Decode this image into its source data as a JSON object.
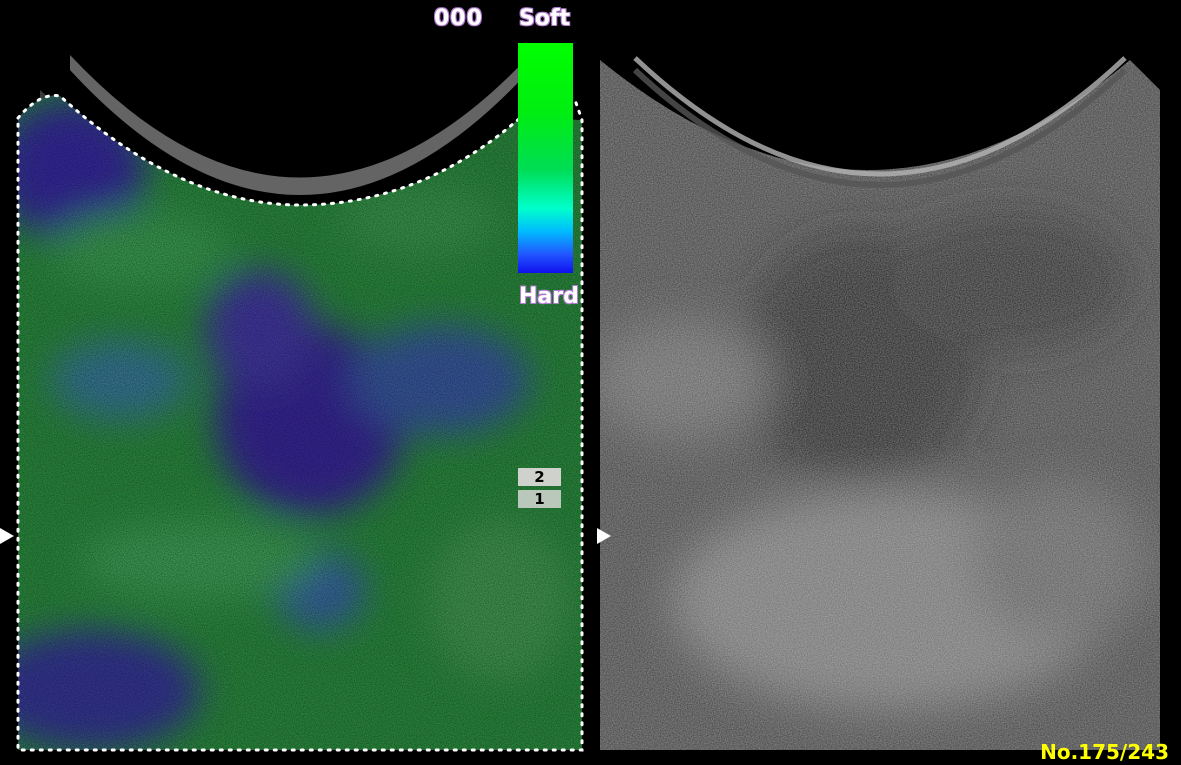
{
  "elastography": {
    "counter": "000",
    "scale_top_label": "Soft",
    "scale_bottom_label": "Hard",
    "scale_colors": [
      "#00ff00",
      "#00dd55",
      "#00ffcc",
      "#00bbff",
      "#1010ee"
    ]
  },
  "markers": {
    "upper": "2",
    "lower": "1"
  },
  "frame": {
    "number_label": "No.175/243"
  },
  "icons": {
    "left_arrow": "triangle-right-icon",
    "right_arrow": "triangle-right-icon"
  }
}
